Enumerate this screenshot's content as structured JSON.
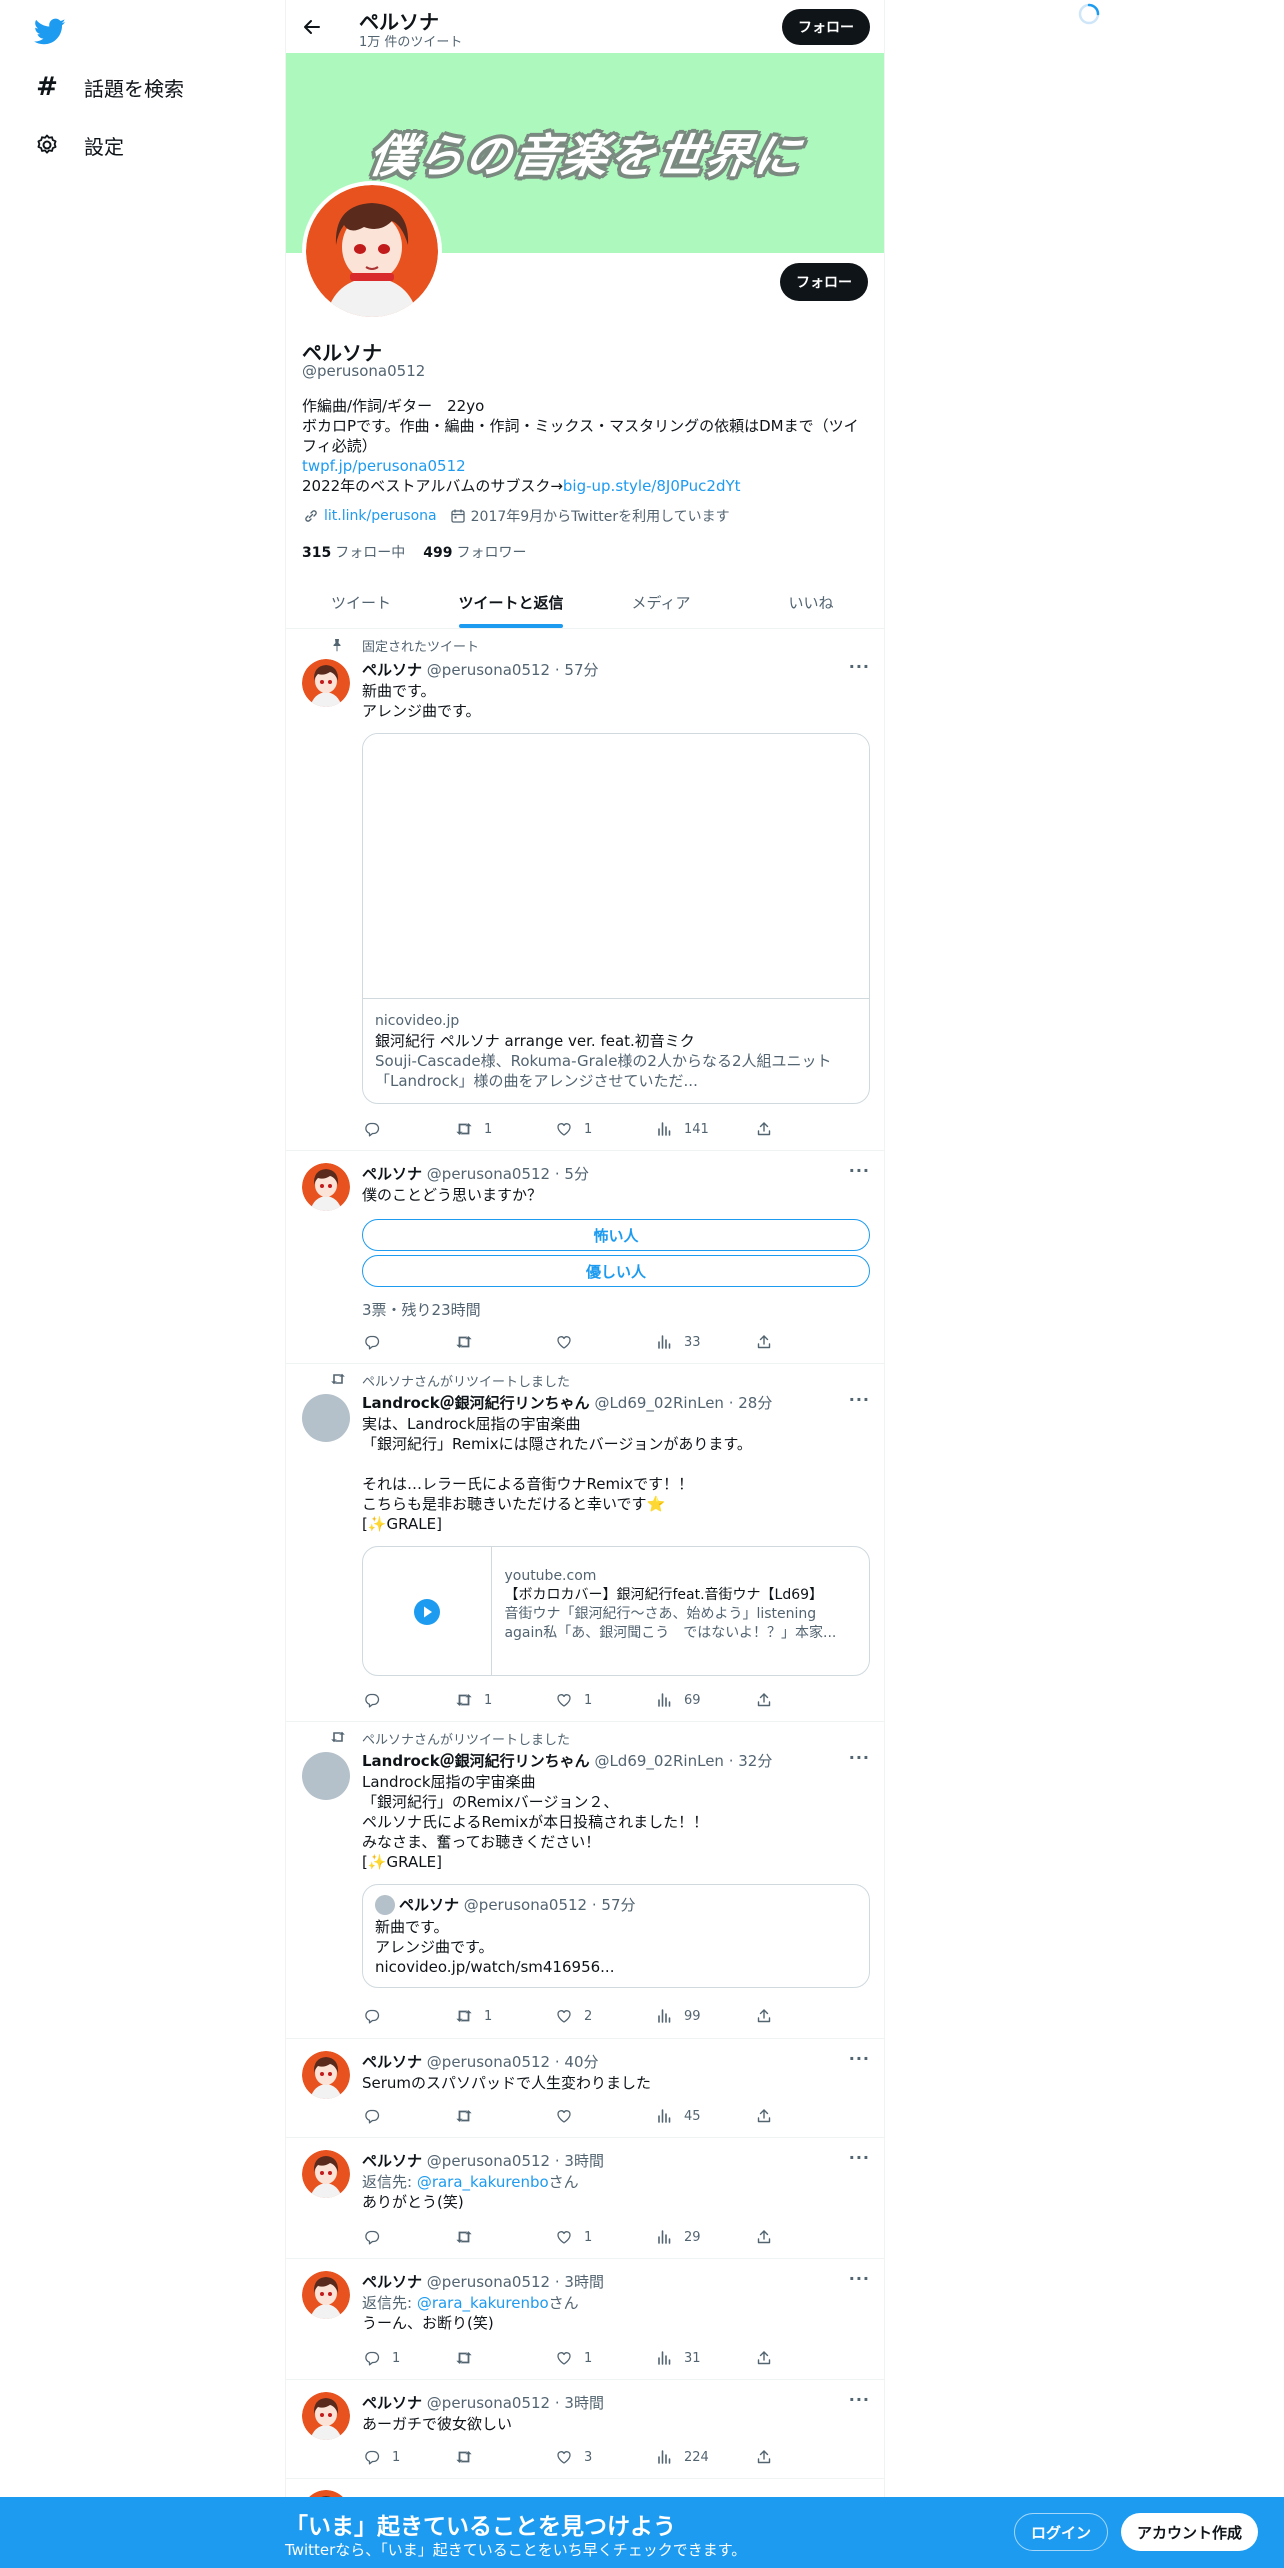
{
  "sidebar": {
    "items": [
      {
        "label": "話題を検索",
        "icon": "hashtag-icon"
      },
      {
        "label": "設定",
        "icon": "gear-icon"
      }
    ]
  },
  "header": {
    "name": "ペルソナ",
    "tweet_count": "1万 件のツイート",
    "follow_label": "フォロー"
  },
  "banner": {
    "text": "僕らの音楽を世界に"
  },
  "profile": {
    "follow_label": "フォロー",
    "name": "ペルソナ",
    "handle": "@perusona0512",
    "bio_line1": "作編曲/作詞/ギター　22yo",
    "bio_line2": "ボカロPです。作曲・編曲・作詞・ミックス・マスタリングの依頼はDMまで（ツイ",
    "bio_line3": "フィ必読）",
    "bio_link1": "twpf.jp/perusona0512",
    "bio_line4": "2022年のベストアルバムのサブスク→",
    "bio_link2": "big-up.style/8J0Puc2dYt",
    "website": "lit.link/perusona",
    "joined": "2017年9月からTwitterを利用しています",
    "following_count": "315",
    "following_label": "フォロー中",
    "followers_count": "499",
    "followers_label": "フォロワー"
  },
  "tabs": [
    {
      "label": "ツイート",
      "active": false
    },
    {
      "label": "ツイートと返信",
      "active": true
    },
    {
      "label": "メディア",
      "active": false
    },
    {
      "label": "いいね",
      "active": false
    }
  ],
  "tweets": [
    {
      "context": "固定されたツイート",
      "name": "ペルソナ",
      "handle": "@perusona0512",
      "time": "· 57分",
      "lines": [
        "新曲です。",
        "アレンジ曲です。"
      ],
      "card": {
        "domain": "nicovideo.jp",
        "title": "銀河紀行 ペルソナ arrange ver. feat.初音ミク",
        "desc1": "Souji-Cascade様、Rokuma-Grale様の2人からなる2人組ユニット",
        "desc2": "「Landrock」様の曲をアレンジさせていただ..."
      },
      "replies": "",
      "retweets": "1",
      "likes": "1",
      "views": "141"
    },
    {
      "name": "ペルソナ",
      "handle": "@perusona0512",
      "time": "· 5分",
      "lines": [
        "僕のことどう思いますか？"
      ],
      "poll": {
        "option1": "怖い人",
        "option2": "優しい人",
        "info": "3票・残り23時間"
      },
      "replies": "",
      "retweets": "",
      "likes": "",
      "views": "33"
    },
    {
      "context": "ペルソナさんがリツイートしました",
      "name": "Landrock＠銀河紀行リンちゃん",
      "handle": "@Ld69_02RinLen",
      "time": "· 28分",
      "lines": [
        "実は、Landrock屈指の宇宙楽曲",
        "「銀河紀行」Remixには隠されたバージョンがあります。",
        "",
        "それは…レラー氏による音街ウナRemixです！！",
        "こちらも是非お聴きいただけると幸いです⭐",
        "[✨GRALE]"
      ],
      "card": {
        "domain": "youtube.com",
        "title": "【ボカロカバー】銀河紀行feat.音街ウナ【Ld69】",
        "desc1": "音街ウナ「銀河紀行〜さあ、始めよう」listening",
        "desc2": "again私「あ、銀河聞こう　ではないよ！？」本家..."
      },
      "replies": "",
      "retweets": "1",
      "likes": "1",
      "views": "69"
    },
    {
      "context": "ペルソナさんがリツイートしました",
      "name": "Landrock＠銀河紀行リンちゃん",
      "handle": "@Ld69_02RinLen",
      "time": "· 32分",
      "lines": [
        "Landrock屈指の宇宙楽曲",
        "「銀河紀行」のRemixバージョン２、",
        "ペルソナ氏によるRemixが本日投稿されました！！",
        "みなさま、奮ってお聴きください！",
        "[✨GRALE]"
      ],
      "quote": {
        "name": "ペルソナ",
        "handle": "@perusona0512",
        "time": "· 57分",
        "line1": "新曲です。",
        "line2": "アレンジ曲です。",
        "line3": "nicovideo.jp/watch/sm416956..."
      },
      "replies": "",
      "retweets": "1",
      "likes": "2",
      "views": "99"
    },
    {
      "name": "ペルソナ",
      "handle": "@perusona0512",
      "time": "· 40分",
      "lines": [
        "Serumのスパソパッドで人生変わりました"
      ],
      "replies": "",
      "retweets": "",
      "likes": "",
      "views": "45"
    },
    {
      "name": "ペルソナ",
      "handle": "@perusona0512",
      "time": "· 3時間",
      "reply_prefix": "返信先: ",
      "reply_to": "@rara_kakurenbo",
      "reply_suffix": "さん",
      "lines": [
        "ありがとう(笑)"
      ],
      "replies": "",
      "retweets": "",
      "likes": "1",
      "views": "29"
    },
    {
      "name": "ペルソナ",
      "handle": "@perusona0512",
      "time": "· 3時間",
      "reply_prefix": "返信先: ",
      "reply_to": "@rara_kakurenbo",
      "reply_suffix": "さん",
      "lines": [
        "うーん、お断り(笑)"
      ],
      "replies": "1",
      "retweets": "",
      "likes": "1",
      "views": "31"
    },
    {
      "name": "ペルソナ",
      "handle": "@perusona0512",
      "time": "· 3時間",
      "lines": [
        "あーガチで彼女欲しい"
      ],
      "replies": "1",
      "retweets": "",
      "likes": "3",
      "views": "224"
    }
  ],
  "bottom_bar": {
    "title": "「いま」起きていることを見つけよう",
    "subtitle": "Twitterなら、「いま」起きていることをいち早くチェックできます。",
    "login_label": "ログイン",
    "signup_label": "アカウント作成"
  },
  "colors": {
    "accent": "#1d9bf0",
    "banner": "#adf9bd",
    "text": "#0f1419",
    "muted": "#536471"
  }
}
